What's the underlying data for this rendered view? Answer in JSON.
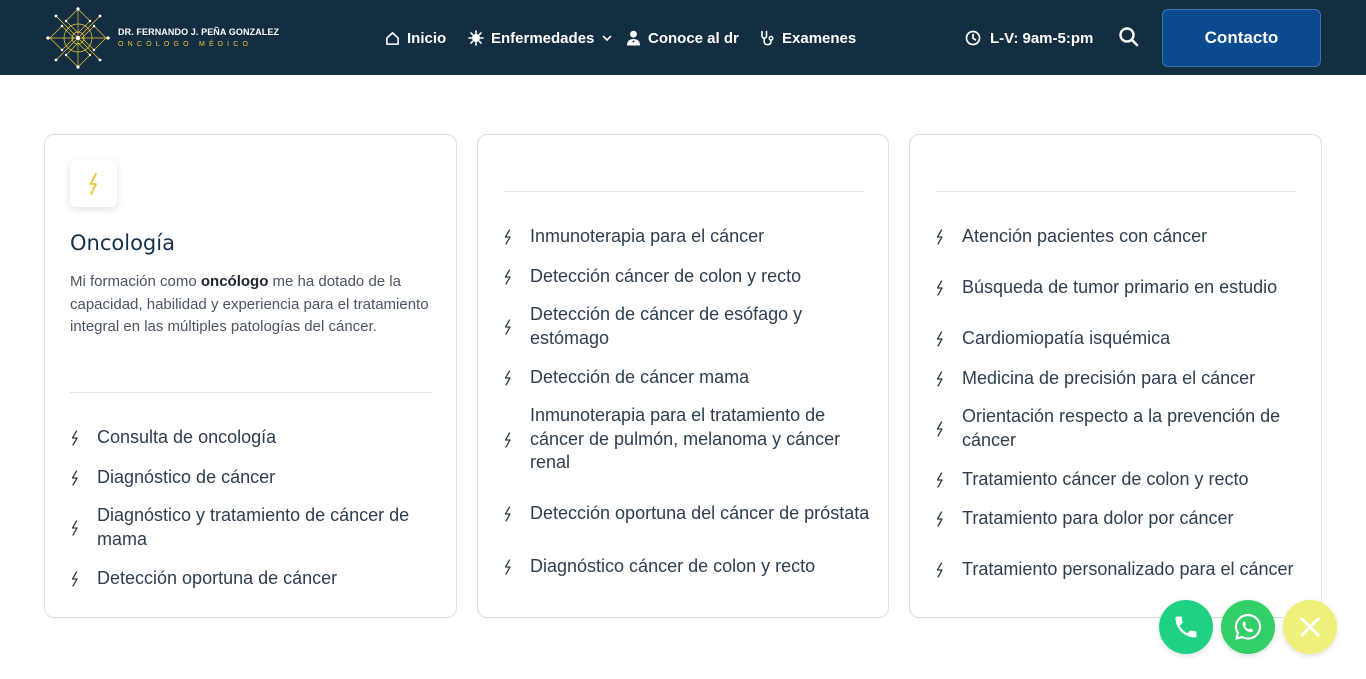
{
  "header": {
    "logo": {
      "name": "DR. FERNANDO J. PEÑA GONZALEZ",
      "subtitle": "ONCÓLOGO MÉDICO"
    },
    "nav": [
      {
        "label": "Inicio",
        "icon": "home-icon"
      },
      {
        "label": "Enfermedades",
        "icon": "virus-icon",
        "has_dropdown": true
      },
      {
        "label": "Conoce al dr",
        "icon": "doctor-icon"
      },
      {
        "label": "Examenes",
        "icon": "stethoscope-icon"
      }
    ],
    "hours": "L-V: 9am-5:pm",
    "contact_label": "Contacto"
  },
  "cards": [
    {
      "title": "Oncología",
      "desc_pre": "Mi formación como ",
      "desc_bold": "oncólogo",
      "desc_post": " me ha dotado de la capacidad, habilidad y experiencia para el tratamiento integral en las múltiples patologías del cáncer.",
      "items": [
        "Consulta de oncología",
        "Diagnóstico de cáncer",
        "Diagnóstico y tratamiento de cáncer de mama",
        "Detección oportuna de cáncer"
      ]
    },
    {
      "items": [
        "Inmunoterapia para el cáncer",
        "Detección cáncer de colon y recto",
        "Detección de cáncer de esófago y estómago",
        "Detección de cáncer mama",
        "Inmunoterapia para el tratamiento de cáncer de pulmón, melanoma y cáncer renal",
        "Detección oportuna del cáncer de próstata",
        "Diagnóstico cáncer de colon y recto"
      ]
    },
    {
      "items": [
        "Atención pacientes con cáncer",
        "Búsqueda de tumor primario en estudio",
        "Cardiomiopatía isquémica",
        "Medicina de precisión para el cáncer",
        "Orientación respecto a la prevención de cáncer",
        "Tratamiento cáncer de colon y recto",
        "Tratamiento para dolor por cáncer",
        "Tratamiento personalizado para el cáncer"
      ]
    }
  ],
  "floating": [
    {
      "name": "phone-button",
      "icon": "phone-icon",
      "color": "#1fd283"
    },
    {
      "name": "whatsapp-button",
      "icon": "whatsapp-icon",
      "color": "#33d06a"
    },
    {
      "name": "close-button",
      "icon": "close-icon",
      "color": "#eef07a"
    }
  ],
  "colors": {
    "header_bg": "#132e41",
    "contact_bg": "#0b4a8f",
    "accent_gold": "#f0c53a"
  }
}
